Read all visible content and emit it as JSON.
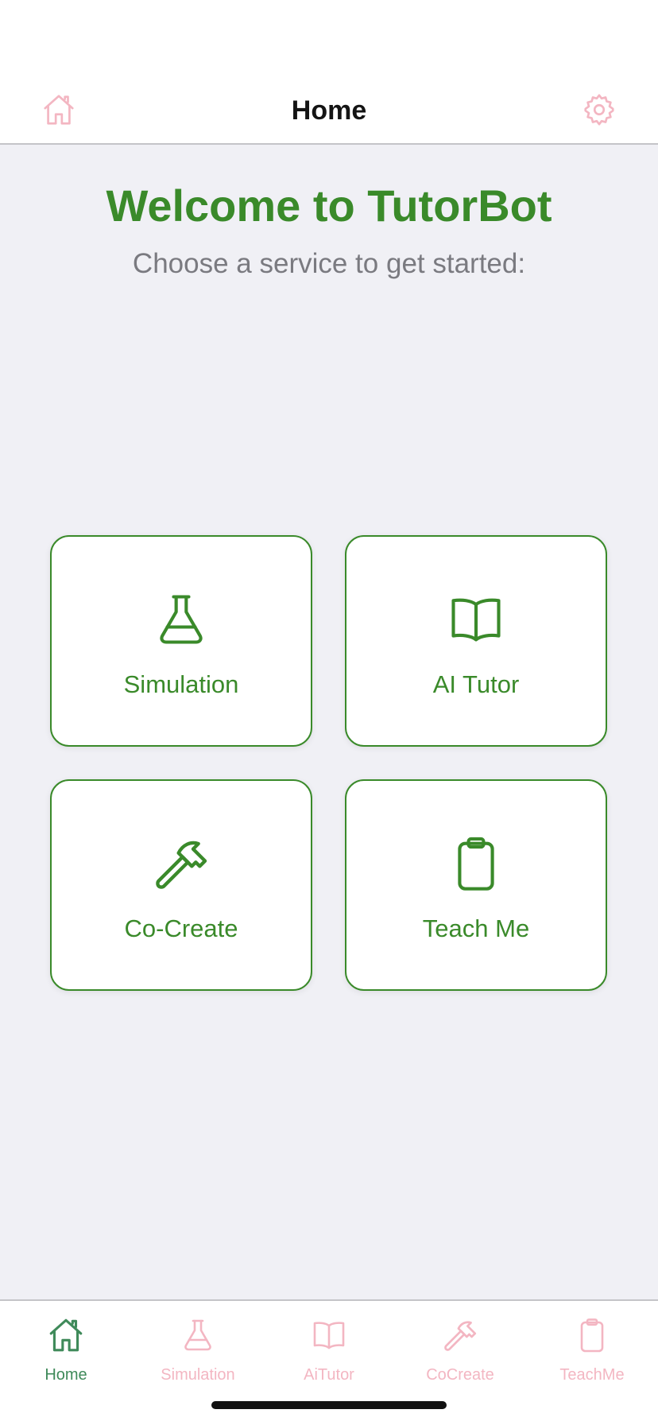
{
  "header": {
    "title": "Home",
    "left_icon": "house-icon",
    "right_icon": "gear-icon",
    "icon_color": "#f3b6c2"
  },
  "main": {
    "title": "Welcome to TutorBot",
    "subtitle": "Choose a service to get started:",
    "accent_color": "#3a8a2a",
    "cards": [
      {
        "label": "Simulation",
        "icon": "flask-icon"
      },
      {
        "label": "AI Tutor",
        "icon": "book-icon"
      },
      {
        "label": "Co-Create",
        "icon": "hammer-icon"
      },
      {
        "label": "Teach Me",
        "icon": "clipboard-icon"
      }
    ]
  },
  "tabbar": {
    "active_color": "#3f8a5a",
    "inactive_color": "#f3b6c2",
    "tabs": [
      {
        "label": "Home",
        "icon": "house-icon",
        "active": true
      },
      {
        "label": "Simulation",
        "icon": "flask-icon",
        "active": false
      },
      {
        "label": "AiTutor",
        "icon": "book-icon",
        "active": false
      },
      {
        "label": "CoCreate",
        "icon": "hammer-icon",
        "active": false
      },
      {
        "label": "TeachMe",
        "icon": "clipboard-icon",
        "active": false
      }
    ]
  }
}
